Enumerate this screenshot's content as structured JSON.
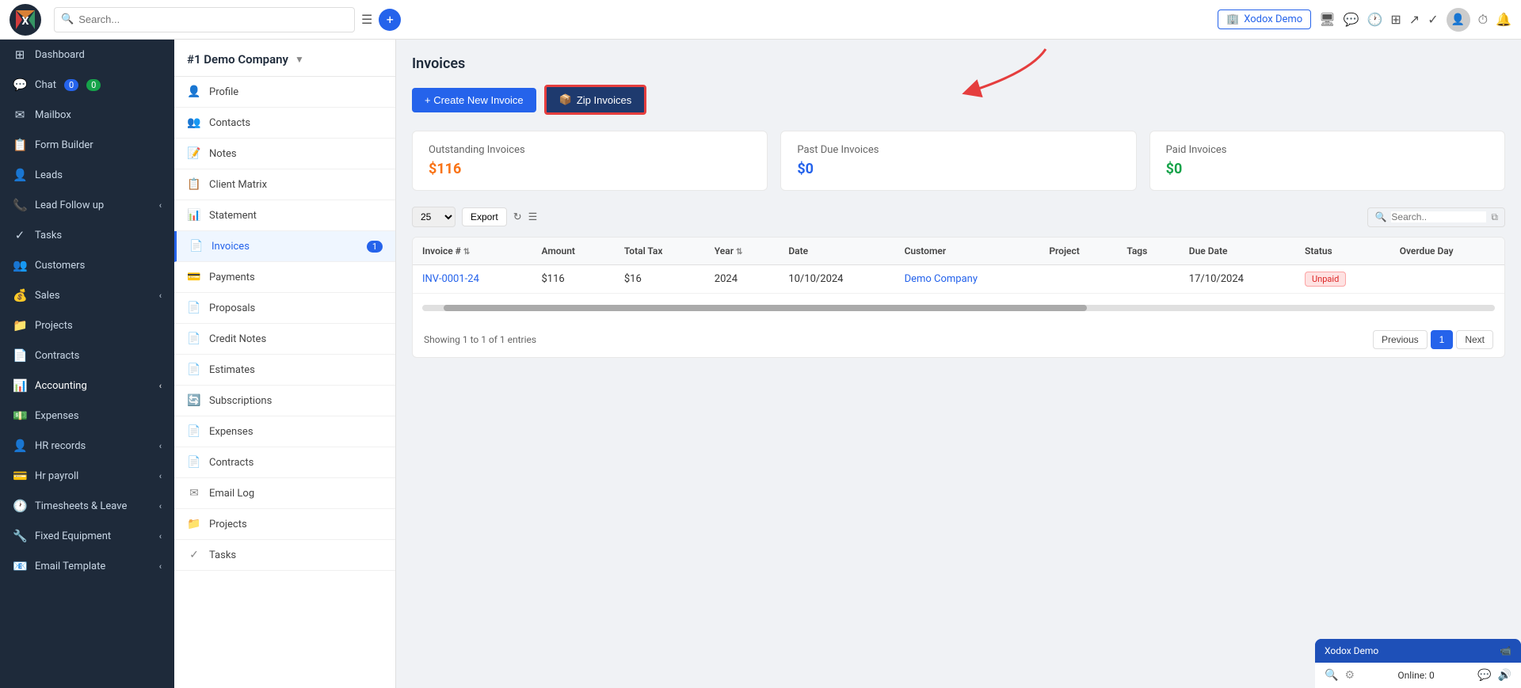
{
  "topbar": {
    "search_placeholder": "Search...",
    "company_label": "Xodox Demo",
    "menu_icon": "☰",
    "add_icon": "+",
    "search_icon": "🔍"
  },
  "sidebar": {
    "toggle_icon": "☰",
    "items": [
      {
        "id": "dashboard",
        "label": "Dashboard",
        "icon": "⊞"
      },
      {
        "id": "chat",
        "label": "Chat",
        "icon": "💬",
        "badge1": "0",
        "badge2": "0"
      },
      {
        "id": "mailbox",
        "label": "Mailbox",
        "icon": "✉"
      },
      {
        "id": "form-builder",
        "label": "Form Builder",
        "icon": "📋"
      },
      {
        "id": "leads",
        "label": "Leads",
        "icon": "👤"
      },
      {
        "id": "lead-follow-up",
        "label": "Lead Follow up",
        "icon": "📞",
        "chevron": "‹"
      },
      {
        "id": "tasks",
        "label": "Tasks",
        "icon": "✓"
      },
      {
        "id": "customers",
        "label": "Customers",
        "icon": "👥"
      },
      {
        "id": "sales",
        "label": "Sales",
        "icon": "💰",
        "chevron": "‹"
      },
      {
        "id": "projects",
        "label": "Projects",
        "icon": "📁"
      },
      {
        "id": "contracts",
        "label": "Contracts",
        "icon": "📄"
      },
      {
        "id": "accounting",
        "label": "Accounting",
        "icon": "📊",
        "chevron": "‹"
      },
      {
        "id": "expenses",
        "label": "Expenses",
        "icon": "💵"
      },
      {
        "id": "hr-records",
        "label": "HR records",
        "icon": "👤",
        "chevron": "‹"
      },
      {
        "id": "hr-payroll",
        "label": "Hr payroll",
        "icon": "💳",
        "chevron": "‹"
      },
      {
        "id": "timesheets",
        "label": "Timesheets & Leave",
        "icon": "🕐",
        "chevron": "‹"
      },
      {
        "id": "fixed-equipment",
        "label": "Fixed Equipment",
        "icon": "🔧",
        "chevron": "‹"
      },
      {
        "id": "email-template",
        "label": "Email Template",
        "icon": "📧",
        "chevron": "‹"
      }
    ]
  },
  "sub_sidebar": {
    "company": "#1 Demo Company",
    "items": [
      {
        "id": "profile",
        "label": "Profile",
        "icon": "👤"
      },
      {
        "id": "contacts",
        "label": "Contacts",
        "icon": "👥"
      },
      {
        "id": "notes",
        "label": "Notes",
        "icon": "📝"
      },
      {
        "id": "client-matrix",
        "label": "Client Matrix",
        "icon": "📋"
      },
      {
        "id": "statement",
        "label": "Statement",
        "icon": "📊"
      },
      {
        "id": "invoices",
        "label": "Invoices",
        "icon": "📄",
        "count": "1",
        "active": true
      },
      {
        "id": "payments",
        "label": "Payments",
        "icon": "💳"
      },
      {
        "id": "proposals",
        "label": "Proposals",
        "icon": "📄"
      },
      {
        "id": "credit-notes",
        "label": "Credit Notes",
        "icon": "📄"
      },
      {
        "id": "estimates",
        "label": "Estimates",
        "icon": "📄"
      },
      {
        "id": "subscriptions",
        "label": "Subscriptions",
        "icon": "🔄"
      },
      {
        "id": "expenses",
        "label": "Expenses",
        "icon": "📄"
      },
      {
        "id": "contracts",
        "label": "Contracts",
        "icon": "📄"
      },
      {
        "id": "email-log",
        "label": "Email Log",
        "icon": "✉"
      },
      {
        "id": "projects",
        "label": "Projects",
        "icon": "📁"
      },
      {
        "id": "tasks",
        "label": "Tasks",
        "icon": "✓"
      }
    ]
  },
  "main": {
    "title": "Invoices",
    "btn_create": "+ Create New Invoice",
    "btn_zip": "Zip Invoices",
    "stats": [
      {
        "id": "outstanding",
        "label": "Outstanding Invoices",
        "value": "$116",
        "color": "orange"
      },
      {
        "id": "past-due",
        "label": "Past Due Invoices",
        "value": "$0",
        "color": "blue"
      },
      {
        "id": "paid",
        "label": "Paid Invoices",
        "value": "$0",
        "color": "green"
      }
    ],
    "table_controls": {
      "per_page": "25",
      "export_label": "Export",
      "search_placeholder": "Search.."
    },
    "table_headers": [
      {
        "key": "invoice_num",
        "label": "Invoice #",
        "sortable": true
      },
      {
        "key": "amount",
        "label": "Amount"
      },
      {
        "key": "total_tax",
        "label": "Total Tax"
      },
      {
        "key": "year",
        "label": "Year",
        "sortable": true
      },
      {
        "key": "date",
        "label": "Date"
      },
      {
        "key": "customer",
        "label": "Customer"
      },
      {
        "key": "project",
        "label": "Project"
      },
      {
        "key": "tags",
        "label": "Tags"
      },
      {
        "key": "due_date",
        "label": "Due Date"
      },
      {
        "key": "status",
        "label": "Status"
      },
      {
        "key": "overdue_day",
        "label": "Overdue Day"
      }
    ],
    "table_rows": [
      {
        "invoice_num": "INV-0001-24",
        "amount": "$116",
        "total_tax": "$16",
        "year": "2024",
        "date": "10/10/2024",
        "customer": "Demo Company",
        "project": "",
        "tags": "",
        "due_date": "17/10/2024",
        "status": "Unpaid",
        "overdue_day": ""
      }
    ],
    "pagination": {
      "info": "Showing 1 to 1 of 1 entries",
      "prev_label": "Previous",
      "next_label": "Next",
      "current_page": "1"
    }
  },
  "chat_widget": {
    "title": "Xodox Demo",
    "online_label": "Online: 0",
    "video_icon": "📹"
  }
}
